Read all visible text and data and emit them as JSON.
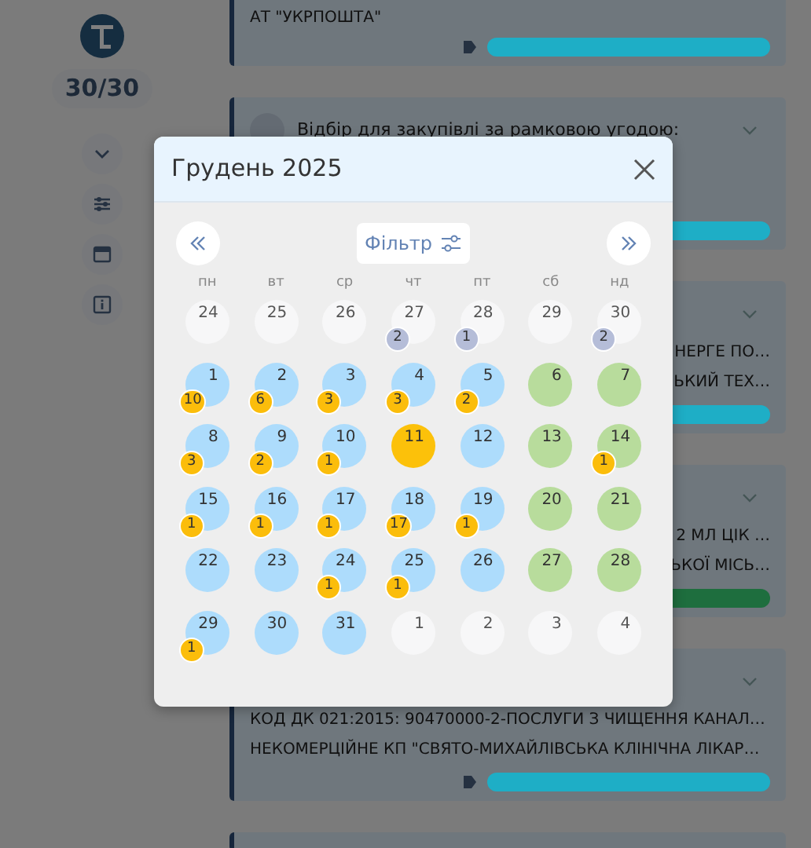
{
  "sidebar": {
    "counter": "30/30"
  },
  "feed": [
    {
      "expandable": false,
      "lines": [
        "АТ \"УКРПОШТА\""
      ],
      "color": "#1eaec6"
    },
    {
      "expandable": true,
      "title": "Відбір для закупівлі за рамковою угодою:",
      "color": "#1eaec6"
    },
    {
      "expandable": true,
      "tail_lines": [
        "НЕРГЕ ПО…",
        "ЬКИЙ ТЕХ…"
      ],
      "color": "#1eaec6"
    },
    {
      "expandable": true,
      "tail_lines": [
        "2 МЛ ЦІК …",
        "ЬКОЇ МІСЬ…"
      ],
      "color": "#1e6e3e"
    },
    {
      "expandable": true,
      "lines": [
        "КОД ДК 021:2015: 90470000-2-ПОСЛУГИ З ЧИЩЕННЯ КАНАЛ…",
        "НЕКОМЕРЦІЙНЕ КП \"СВЯТО-МИХАЙЛІВСЬКА КЛІНІЧНА ЛІКАР…"
      ],
      "color": "#1eaec6"
    },
    {
      "expandable": false
    }
  ],
  "calendar": {
    "title": "Грудень 2025",
    "filter_label": "Фільтр",
    "weekdays": [
      "пн",
      "вт",
      "ср",
      "чт",
      "пт",
      "сб",
      "нд"
    ],
    "weeks": [
      [
        {
          "day": "24",
          "kind": "other"
        },
        {
          "day": "25",
          "kind": "other"
        },
        {
          "day": "26",
          "kind": "other"
        },
        {
          "day": "27",
          "kind": "other",
          "count": "2"
        },
        {
          "day": "28",
          "kind": "other",
          "count": "1"
        },
        {
          "day": "29",
          "kind": "other"
        },
        {
          "day": "30",
          "kind": "other",
          "count": "2"
        }
      ],
      [
        {
          "day": "1",
          "kind": "weekday",
          "count": "10"
        },
        {
          "day": "2",
          "kind": "weekday",
          "count": "6"
        },
        {
          "day": "3",
          "kind": "weekday",
          "count": "3"
        },
        {
          "day": "4",
          "kind": "weekday",
          "count": "3"
        },
        {
          "day": "5",
          "kind": "weekday",
          "count": "2"
        },
        {
          "day": "6",
          "kind": "weekend"
        },
        {
          "day": "7",
          "kind": "weekend"
        }
      ],
      [
        {
          "day": "8",
          "kind": "weekday",
          "count": "3"
        },
        {
          "day": "9",
          "kind": "weekday",
          "count": "2"
        },
        {
          "day": "10",
          "kind": "weekday",
          "count": "1"
        },
        {
          "day": "11",
          "kind": "today"
        },
        {
          "day": "12",
          "kind": "weekday"
        },
        {
          "day": "13",
          "kind": "weekend"
        },
        {
          "day": "14",
          "kind": "weekend",
          "count": "1"
        }
      ],
      [
        {
          "day": "15",
          "kind": "weekday",
          "count": "1"
        },
        {
          "day": "16",
          "kind": "weekday",
          "count": "1"
        },
        {
          "day": "17",
          "kind": "weekday",
          "count": "1"
        },
        {
          "day": "18",
          "kind": "weekday",
          "count": "17"
        },
        {
          "day": "19",
          "kind": "weekday",
          "count": "1"
        },
        {
          "day": "20",
          "kind": "weekend"
        },
        {
          "day": "21",
          "kind": "weekend"
        }
      ],
      [
        {
          "day": "22",
          "kind": "weekday"
        },
        {
          "day": "23",
          "kind": "weekday"
        },
        {
          "day": "24",
          "kind": "weekday",
          "count": "1"
        },
        {
          "day": "25",
          "kind": "weekday",
          "count": "1"
        },
        {
          "day": "26",
          "kind": "weekday"
        },
        {
          "day": "27",
          "kind": "weekend"
        },
        {
          "day": "28",
          "kind": "weekend"
        }
      ],
      [
        {
          "day": "29",
          "kind": "weekday",
          "count": "1"
        },
        {
          "day": "30",
          "kind": "weekday"
        },
        {
          "day": "31",
          "kind": "weekday"
        },
        {
          "day": "1",
          "kind": "other"
        },
        {
          "day": "2",
          "kind": "other"
        },
        {
          "day": "3",
          "kind": "other"
        },
        {
          "day": "4",
          "kind": "other"
        }
      ]
    ]
  }
}
